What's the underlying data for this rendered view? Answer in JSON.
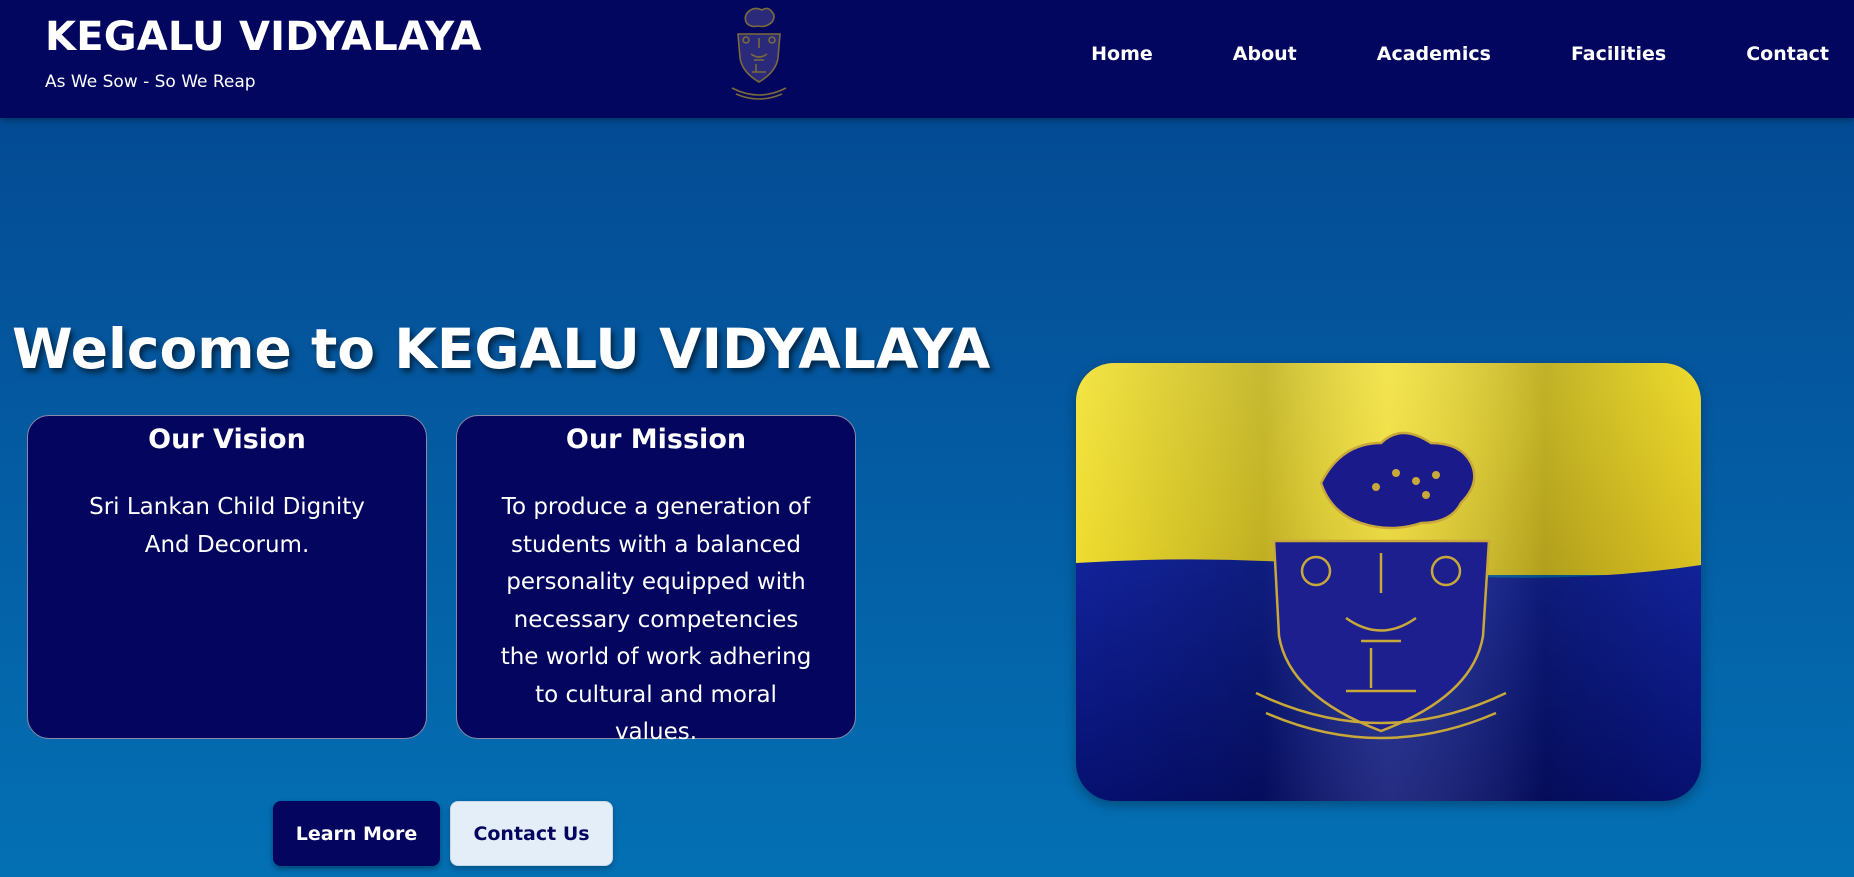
{
  "header": {
    "title": "KEGALU VIDYALAYA",
    "tagline": "As We Sow - So We Reap",
    "logo_icon": "school-crest-icon"
  },
  "nav": {
    "items": [
      {
        "label": "Home"
      },
      {
        "label": "About"
      },
      {
        "label": "Academics"
      },
      {
        "label": "Facilities"
      },
      {
        "label": "Contact"
      }
    ]
  },
  "hero": {
    "title": "Welcome to KEGALU VIDYALAYA",
    "vision": {
      "heading": "Our Vision",
      "text": "Sri Lankan Child Dignity And Decorum."
    },
    "mission": {
      "heading": "Our Mission",
      "text": "To produce a generation of students with a balanced personality equipped with necessary competencies the world of work adhering to cultural and moral values."
    },
    "buttons": {
      "learn_more": "Learn More",
      "contact_us": "Contact Us"
    },
    "image": "school-flag-with-crest"
  },
  "colors": {
    "navbar": "#03065e",
    "background_top": "#034690",
    "background_bottom": "#0470b4",
    "card": "#03055e",
    "flag_yellow": "#f3e03a",
    "flag_blue": "#0a1a8c",
    "crest_gold": "#c9a83a"
  }
}
